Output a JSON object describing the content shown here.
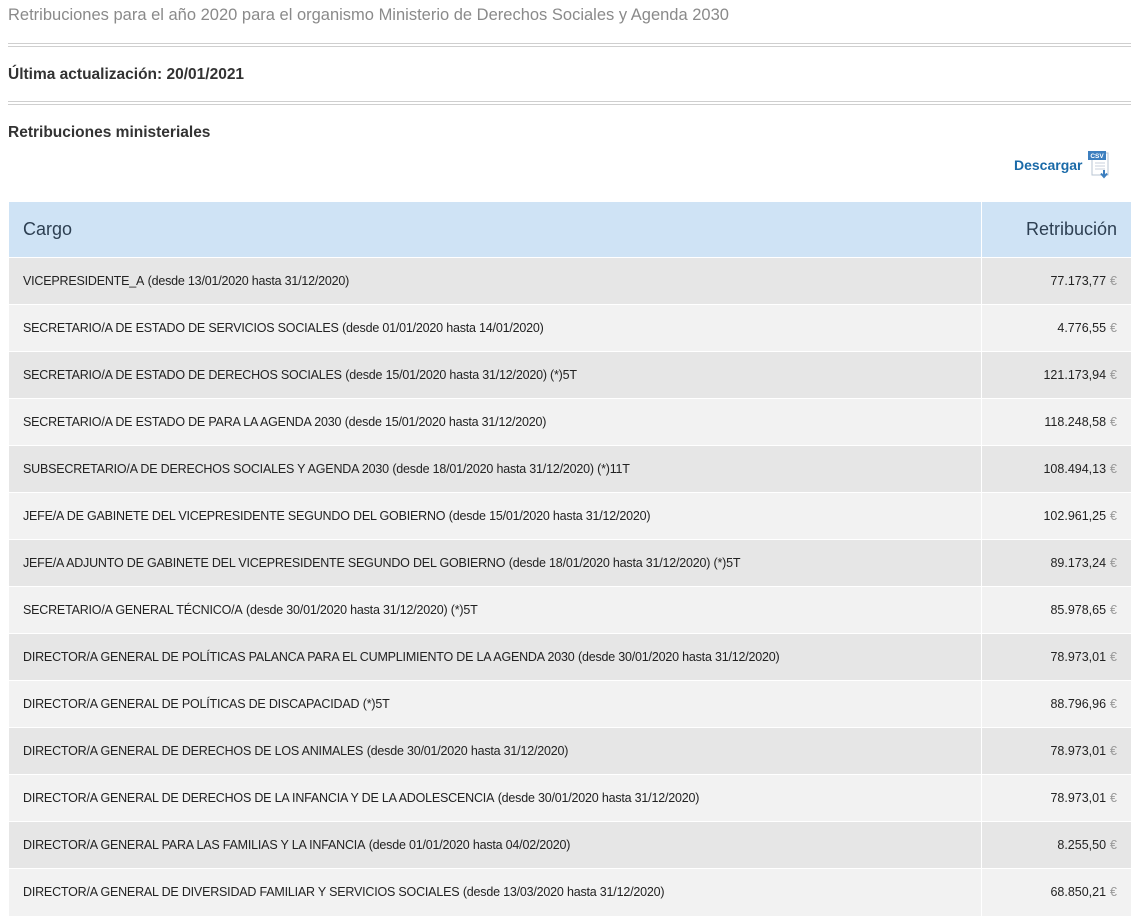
{
  "page": {
    "title": "Retribuciones para el año 2020 para el organismo Ministerio de Derechos Sociales y Agenda 2030",
    "last_update": "Última actualización: 20/01/2021",
    "section_title": "Retribuciones ministeriales",
    "download_label": "Descargar",
    "download_icon": "csv-download-icon",
    "download_icon_text": "CSV"
  },
  "table": {
    "headers": {
      "cargo": "Cargo",
      "retribucion": "Retribución"
    },
    "currency_symbol": "€",
    "header_bg": "#cfe3f5",
    "rows": [
      {
        "cargo": "VICEPRESIDENTE_A",
        "dates": "(desde 13/01/2020 hasta 31/12/2020)",
        "amount": "77.173,77"
      },
      {
        "cargo": "SECRETARIO/A DE ESTADO DE SERVICIOS SOCIALES",
        "dates": "(desde 01/01/2020 hasta 14/01/2020)",
        "amount": "4.776,55"
      },
      {
        "cargo": "SECRETARIO/A DE ESTADO DE DERECHOS SOCIALES",
        "dates": "(desde 15/01/2020 hasta 31/12/2020) (*)5T",
        "amount": "121.173,94"
      },
      {
        "cargo": "SECRETARIO/A DE ESTADO DE PARA LA AGENDA 2030",
        "dates": "(desde 15/01/2020 hasta 31/12/2020)",
        "amount": "118.248,58"
      },
      {
        "cargo": "SUBSECRETARIO/A DE DERECHOS SOCIALES Y AGENDA 2030",
        "dates": "(desde 18/01/2020 hasta 31/12/2020) (*)11T",
        "amount": "108.494,13"
      },
      {
        "cargo": "JEFE/A DE GABINETE DEL VICEPRESIDENTE SEGUNDO DEL GOBIERNO",
        "dates": "(desde 15/01/2020 hasta 31/12/2020)",
        "amount": "102.961,25"
      },
      {
        "cargo": "JEFE/A ADJUNTO DE GABINETE DEL VICEPRESIDENTE SEGUNDO DEL GOBIERNO",
        "dates": "(desde 18/01/2020 hasta 31/12/2020) (*)5T",
        "amount": "89.173,24"
      },
      {
        "cargo": "SECRETARIO/A GENERAL TÉCNICO/A",
        "dates": "(desde 30/01/2020 hasta 31/12/2020) (*)5T",
        "amount": "85.978,65"
      },
      {
        "cargo": "DIRECTOR/A GENERAL DE POLÍTICAS PALANCA PARA EL CUMPLIMIENTO DE LA AGENDA 2030",
        "dates": "(desde 30/01/2020 hasta 31/12/2020)",
        "amount": "78.973,01"
      },
      {
        "cargo": "DIRECTOR/A GENERAL DE POLÍTICAS DE DISCAPACIDAD",
        "dates": "(*)5T",
        "amount": "88.796,96"
      },
      {
        "cargo": "DIRECTOR/A GENERAL DE DERECHOS DE LOS ANIMALES",
        "dates": "(desde 30/01/2020 hasta 31/12/2020)",
        "amount": "78.973,01"
      },
      {
        "cargo": "DIRECTOR/A GENERAL DE DERECHOS DE LA INFANCIA Y DE LA ADOLESCENCIA",
        "dates": "(desde 30/01/2020 hasta 31/12/2020)",
        "amount": "78.973,01"
      },
      {
        "cargo": "DIRECTOR/A GENERAL PARA LAS FAMILIAS Y LA INFANCIA",
        "dates": "(desde 01/01/2020 hasta 04/02/2020)",
        "amount": "8.255,50"
      },
      {
        "cargo": "DIRECTOR/A GENERAL DE DIVERSIDAD FAMILIAR Y SERVICIOS SOCIALES",
        "dates": "(desde 13/03/2020 hasta 31/12/2020)",
        "amount": "68.850,21"
      }
    ]
  }
}
